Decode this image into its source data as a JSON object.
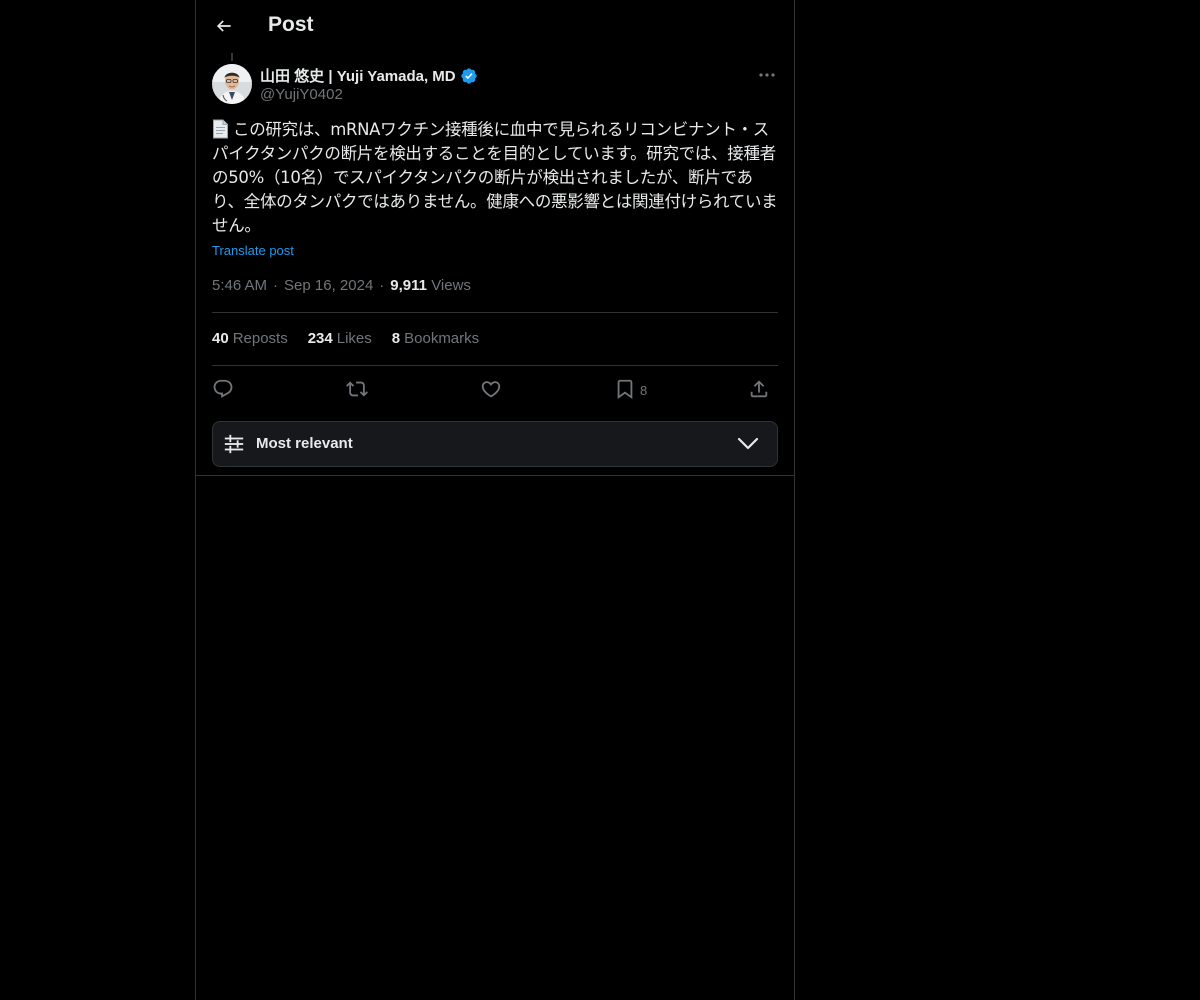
{
  "header": {
    "title": "Post"
  },
  "post": {
    "author": {
      "name": "山田 悠史 | Yuji Yamada, MD",
      "handle": "@YujiY0402",
      "verified": true
    },
    "text": "この研究は、mRNAワクチン接種後に血中で見られるリコンビナント・スパイクタンパクの断片を検出することを目的としています。研究では、接種者の50%（10名）でスパイクタンパクの断片が検出されましたが、断片であり、全体のタンパクではありません。健康への悪影響とは関連付けられていません。",
    "leading_icon": "page-document-icon",
    "translate_label": "Translate post",
    "time": "5:46 AM",
    "date": "Sep 16, 2024",
    "separator": "·",
    "views_count": "9,911",
    "views_label": "Views"
  },
  "stats": {
    "reposts_count": "40",
    "reposts_label": "Reposts",
    "likes_count": "234",
    "likes_label": "Likes",
    "bookmarks_count": "8",
    "bookmarks_label": "Bookmarks"
  },
  "actions": {
    "reply_icon": "reply-icon",
    "repost_icon": "repost-icon",
    "like_icon": "heart-icon",
    "bookmark_icon": "bookmark-icon",
    "bookmark_count": "8",
    "share_icon": "share-icon"
  },
  "sort": {
    "label": "Most relevant",
    "icon": "sliders-icon"
  },
  "colors": {
    "background": "#000000",
    "text": "#e7e9ea",
    "muted": "#71767b",
    "accent": "#1d9bf0",
    "border": "#2f3336"
  }
}
